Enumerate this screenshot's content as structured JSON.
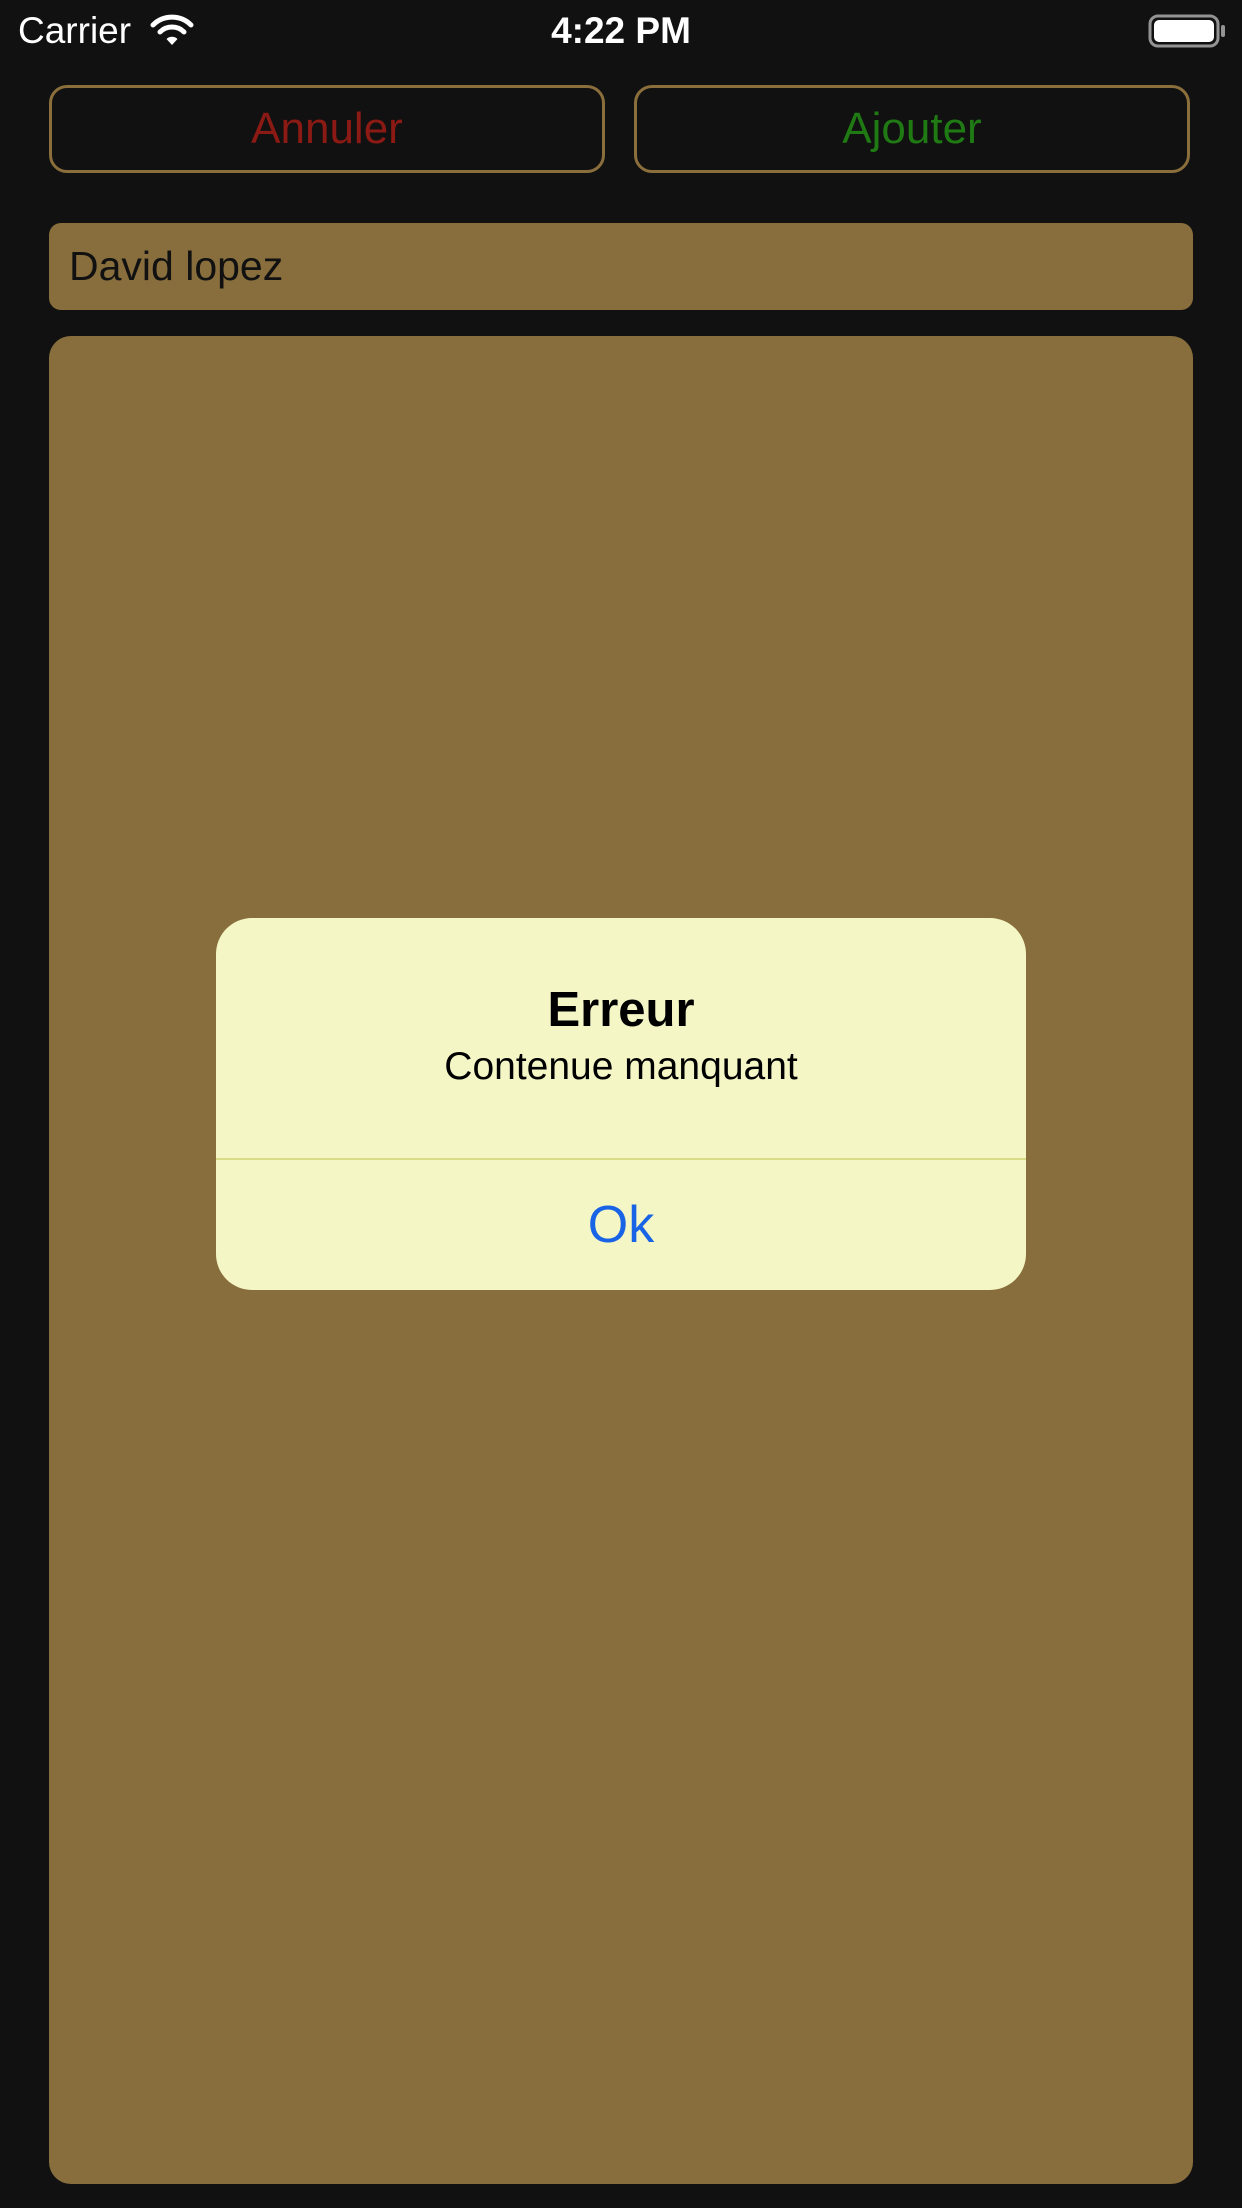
{
  "status_bar": {
    "carrier": "Carrier",
    "time": "4:22 PM",
    "wifi_icon": "wifi-icon",
    "battery_icon": "battery-icon"
  },
  "toolbar": {
    "cancel_label": "Annuler",
    "add_label": "Ajouter"
  },
  "form": {
    "title_value": "David lopez",
    "content_value": ""
  },
  "alert": {
    "title": "Erreur",
    "message": "Contenue manquant",
    "ok_label": "Ok"
  },
  "colors": {
    "background": "#111111",
    "field_background": "#886e3c",
    "button_border": "#8a6e3b",
    "cancel_text": "#8b1a14",
    "add_text": "#1f7a14",
    "alert_background": "#f5f6c6",
    "alert_action": "#1964e6"
  }
}
